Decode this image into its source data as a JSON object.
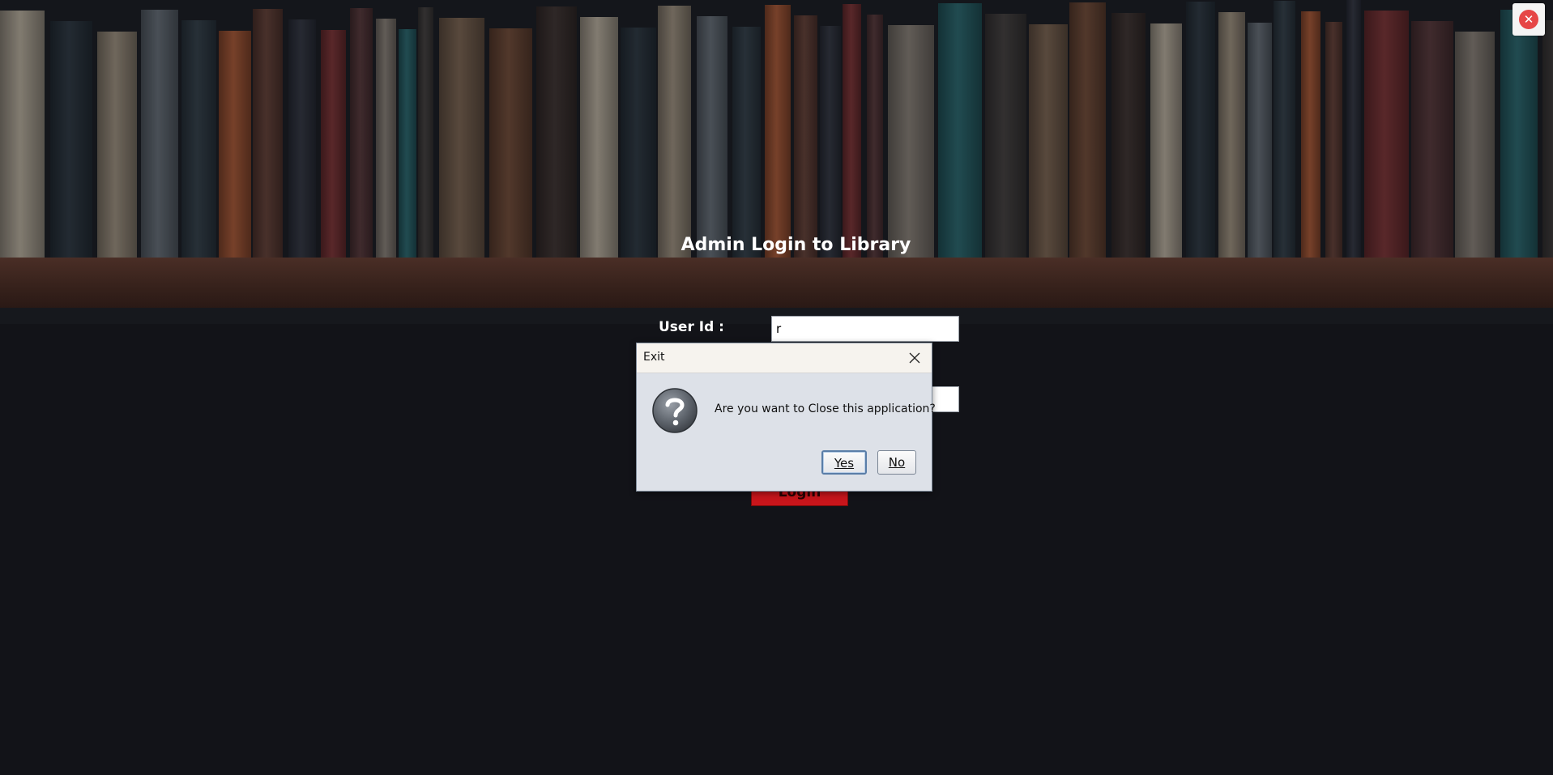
{
  "login": {
    "title": "Admin Login to Library",
    "userid_label": "User Id :",
    "userid_value": "r",
    "password_value": "",
    "login_button": "Login"
  },
  "app_close": {
    "icon": "close-circle-icon",
    "glyph": "✕",
    "color": "#e64646"
  },
  "dialog": {
    "title": "Exit",
    "message": "Are you want to Close this application?",
    "yes_label": "Yes",
    "no_label": "No",
    "icon": "question-icon"
  }
}
